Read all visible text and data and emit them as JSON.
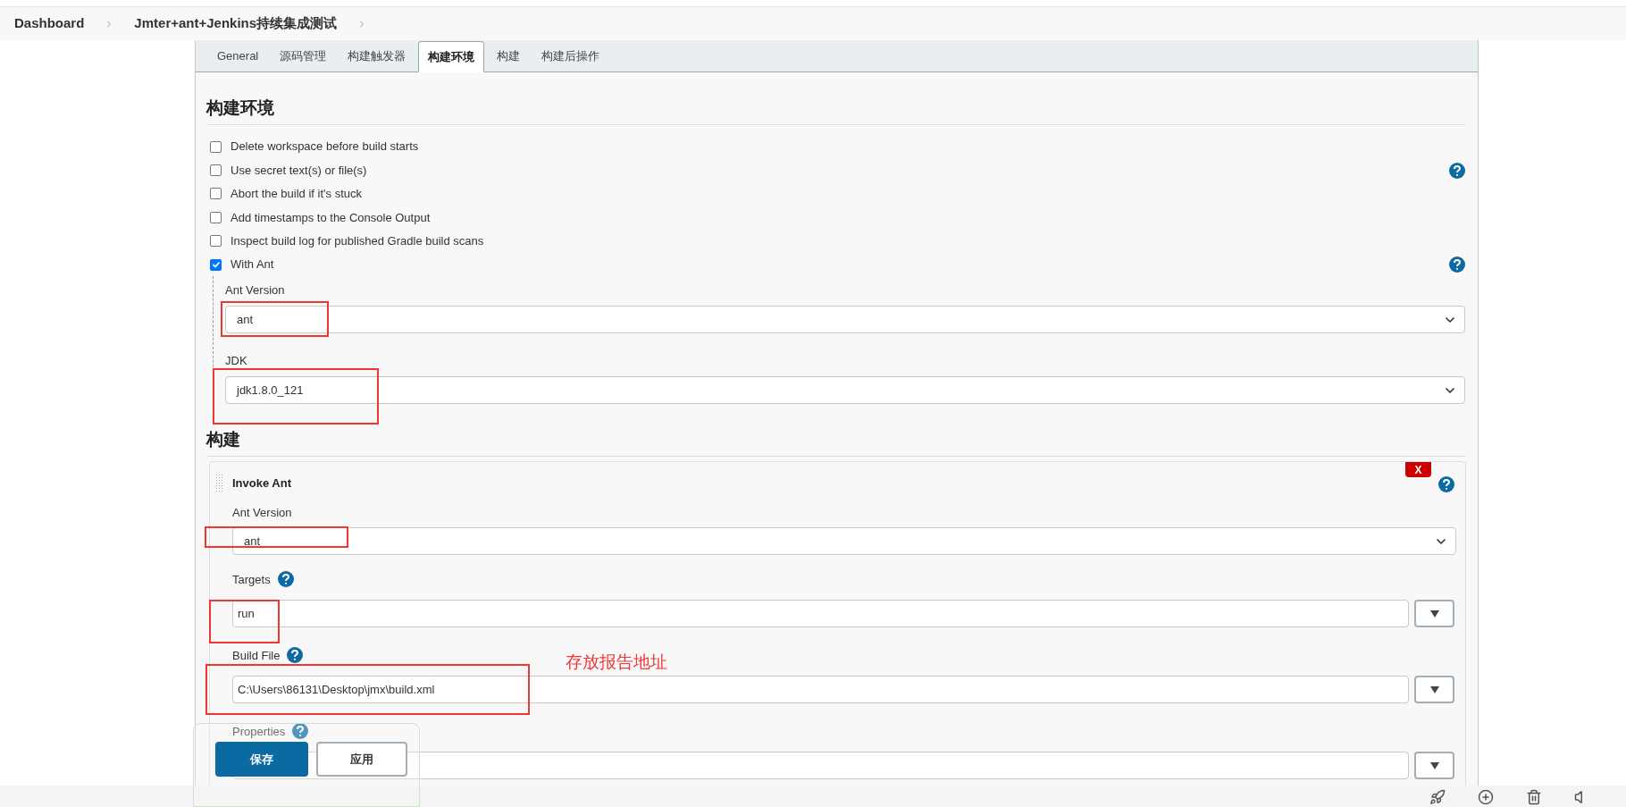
{
  "breadcrumb": [
    {
      "label": "Dashboard"
    },
    {
      "label": "Jmter+ant+Jenkins持续集成测试"
    }
  ],
  "tabs": [
    {
      "label": "General",
      "selected": false
    },
    {
      "label": "源码管理",
      "selected": false
    },
    {
      "label": "构建触发器",
      "selected": false
    },
    {
      "label": "构建环境",
      "selected": true
    },
    {
      "label": "构建",
      "selected": false
    },
    {
      "label": "构建后操作",
      "selected": false
    }
  ],
  "build_environment": {
    "heading": "构建环境",
    "options": [
      {
        "label": "Delete workspace before build starts",
        "checked": false,
        "help": false
      },
      {
        "label": "Use secret text(s) or file(s)",
        "checked": false,
        "help": true
      },
      {
        "label": "Abort the build if it's stuck",
        "checked": false,
        "help": false
      },
      {
        "label": "Add timestamps to the Console Output",
        "checked": false,
        "help": false
      },
      {
        "label": "Inspect build log for published Gradle build scans",
        "checked": false,
        "help": false
      },
      {
        "label": "With Ant",
        "checked": true,
        "help": true
      }
    ],
    "ant_fields": [
      {
        "label": "Ant Version",
        "value": "ant"
      },
      {
        "label": "JDK",
        "value": "jdk1.8.0_121"
      }
    ]
  },
  "build": {
    "heading": "构建",
    "step": {
      "title": "Invoke Ant",
      "delete_label": "X",
      "fields": [
        {
          "kind": "select",
          "label": "Ant Version",
          "value": "ant",
          "help": false
        },
        {
          "kind": "combo",
          "label": "Targets",
          "value": "run",
          "help": true
        },
        {
          "kind": "combo",
          "label": "Build File",
          "value": "C:\\Users\\86131\\Desktop\\jmx\\build.xml",
          "help": true
        },
        {
          "kind": "combo",
          "label": "Properties",
          "help": true
        }
      ]
    }
  },
  "note": "存放报告地址",
  "actions": [
    {
      "label": "保存",
      "kind": "primary"
    },
    {
      "label": "应用",
      "kind": "secondary"
    }
  ]
}
